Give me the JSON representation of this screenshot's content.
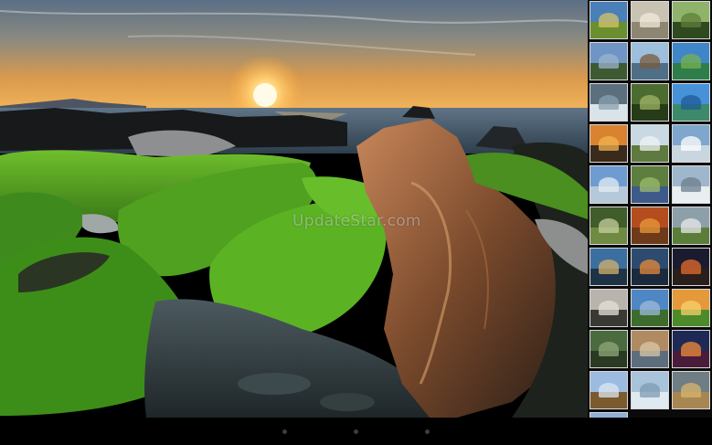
{
  "watermark": "UpdateStar.com",
  "wallpaper": {
    "subject": "mossy-rocks-sunset-coast"
  },
  "thumbnails": [
    {
      "name": "thumb-1",
      "sky": "#4a7fb8",
      "ground": "#6b8f2e",
      "accent": "#d6c36a"
    },
    {
      "name": "thumb-2",
      "sky": "#c9c3b3",
      "ground": "#8e8672",
      "accent": "#f1ead9"
    },
    {
      "name": "thumb-3",
      "sky": "#8fb36a",
      "ground": "#2f4a1e",
      "accent": "#5f7f3a"
    },
    {
      "name": "thumb-4",
      "sky": "#6f95c7",
      "ground": "#3e5a33",
      "accent": "#9bb4cf"
    },
    {
      "name": "thumb-5",
      "sky": "#9dbfdb",
      "ground": "#4f6e87",
      "accent": "#7a5b3b"
    },
    {
      "name": "thumb-6",
      "sky": "#3f86c9",
      "ground": "#2e7d4a",
      "accent": "#78b04f"
    },
    {
      "name": "thumb-7",
      "sky": "#5c6f7e",
      "ground": "#d9e3ea",
      "accent": "#8aa0b0"
    },
    {
      "name": "thumb-8",
      "sky": "#4b6b30",
      "ground": "#263b18",
      "accent": "#a0b466"
    },
    {
      "name": "thumb-9",
      "sky": "#4791d8",
      "ground": "#3c8a6a",
      "accent": "#1d5b9a"
    },
    {
      "name": "thumb-10",
      "sky": "#d9822f",
      "ground": "#3a2a1b",
      "accent": "#f0b453"
    },
    {
      "name": "thumb-11",
      "sky": "#c9d9e4",
      "ground": "#5f7a3e",
      "accent": "#eef3f4"
    },
    {
      "name": "thumb-12",
      "sky": "#7fa6cc",
      "ground": "#c8d6e0",
      "accent": "#ffffff"
    },
    {
      "name": "thumb-13",
      "sky": "#6e9cd1",
      "ground": "#b6c9da",
      "accent": "#e4ecf2"
    },
    {
      "name": "thumb-14",
      "sky": "#5d7e3f",
      "ground": "#3d5a8a",
      "accent": "#9ebe6a"
    },
    {
      "name": "thumb-15",
      "sky": "#9fb7cc",
      "ground": "#e9eef1",
      "accent": "#6b7d8c"
    },
    {
      "name": "thumb-16",
      "sky": "#3f5c2a",
      "ground": "#6f8a43",
      "accent": "#c7cf9e"
    },
    {
      "name": "thumb-17",
      "sky": "#b44d1e",
      "ground": "#6e3a1a",
      "accent": "#e89a3c"
    },
    {
      "name": "thumb-18",
      "sky": "#8da0aa",
      "ground": "#5c7d39",
      "accent": "#e8eaea"
    },
    {
      "name": "thumb-19",
      "sky": "#3b6fa0",
      "ground": "#1f3347",
      "accent": "#d6b06b"
    },
    {
      "name": "thumb-20",
      "sky": "#2d4b6e",
      "ground": "#1c2a3d",
      "accent": "#e88a3a"
    },
    {
      "name": "thumb-21",
      "sky": "#1b1b30",
      "ground": "#2a1f1a",
      "accent": "#e76d2b"
    },
    {
      "name": "thumb-22",
      "sky": "#b8b3ad",
      "ground": "#3a3a35",
      "accent": "#e6e2d8"
    },
    {
      "name": "thumb-23",
      "sky": "#4f86c4",
      "ground": "#3e6c2d",
      "accent": "#9cb9dc"
    },
    {
      "name": "thumb-24",
      "sky": "#e59a3a",
      "ground": "#4d8a2a",
      "accent": "#f6d06b"
    },
    {
      "name": "thumb-25",
      "sky": "#4b6a3e",
      "ground": "#2a3a22",
      "accent": "#90a87a"
    },
    {
      "name": "thumb-26",
      "sky": "#b08b62",
      "ground": "#5c6e7e",
      "accent": "#d9c7a6"
    },
    {
      "name": "thumb-27",
      "sky": "#1e2a55",
      "ground": "#4a1c3a",
      "accent": "#f28c3a"
    },
    {
      "name": "thumb-28",
      "sky": "#9bbbe0",
      "ground": "#7b5a2e",
      "accent": "#dce7f1"
    },
    {
      "name": "thumb-29",
      "sky": "#a9c3da",
      "ground": "#dfe9f0",
      "accent": "#7d9bb3"
    },
    {
      "name": "thumb-30",
      "sky": "#6f7d84",
      "ground": "#a78652",
      "accent": "#d9b56b"
    },
    {
      "name": "thumb-31",
      "sky": "#8fb0d6",
      "ground": "#c9d6e2",
      "accent": "#ffffff"
    }
  ],
  "nav_bar": {
    "dots": 3
  }
}
